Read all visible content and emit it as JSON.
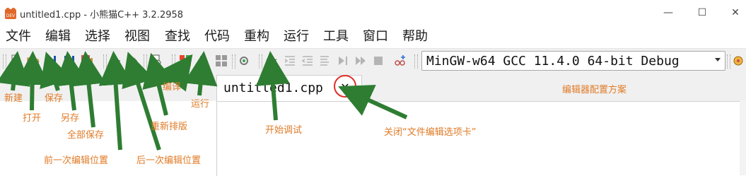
{
  "window": {
    "title": "untitled1.cpp - 小熊猫C++ 3.2.2958",
    "minimize_glyph": "—",
    "maximize_glyph": "☐",
    "close_glyph": "✕"
  },
  "menu": [
    "文件",
    "编辑",
    "选择",
    "视图",
    "查找",
    "代码",
    "重构",
    "运行",
    "工具",
    "窗口",
    "帮助"
  ],
  "toolbar": {
    "buttons": [
      "new-file-icon",
      "open-folder-icon",
      "save-icon",
      "save-as-icon",
      "save-all-icon",
      "back-arrow-icon",
      "forward-arrow-icon",
      "reformat-icon",
      "compile-icon",
      "run-icon",
      "compile-run-icon",
      "compile-settings-icon",
      "debug-icon",
      "indent-icon",
      "unindent-icon",
      "step-icon",
      "continue-icon",
      "stop-icon",
      "watch-icon"
    ],
    "compiler_value": "MinGW-w64 GCC 11.4.0 64-bit Debug"
  },
  "editor": {
    "tab_label": "untitled1.cpp",
    "tab_close": "✕"
  },
  "colors": {
    "annotation": "#e07b27",
    "arrow": "#2e7d32",
    "highlight_ring": "#e0302a"
  },
  "annotations": {
    "new": "新建",
    "open": "打开",
    "save": "保存",
    "save_as": "另存",
    "save_all": "全部保存",
    "prev_edit": "前一次编辑位置",
    "next_edit": "后一次编辑位置",
    "reformat": "重新排版",
    "compile": "编译",
    "run": "运行",
    "debug": "开始调试",
    "close_tab": "关闭“文件编辑选项卡”",
    "editor_scheme": "编辑器配置方案"
  }
}
